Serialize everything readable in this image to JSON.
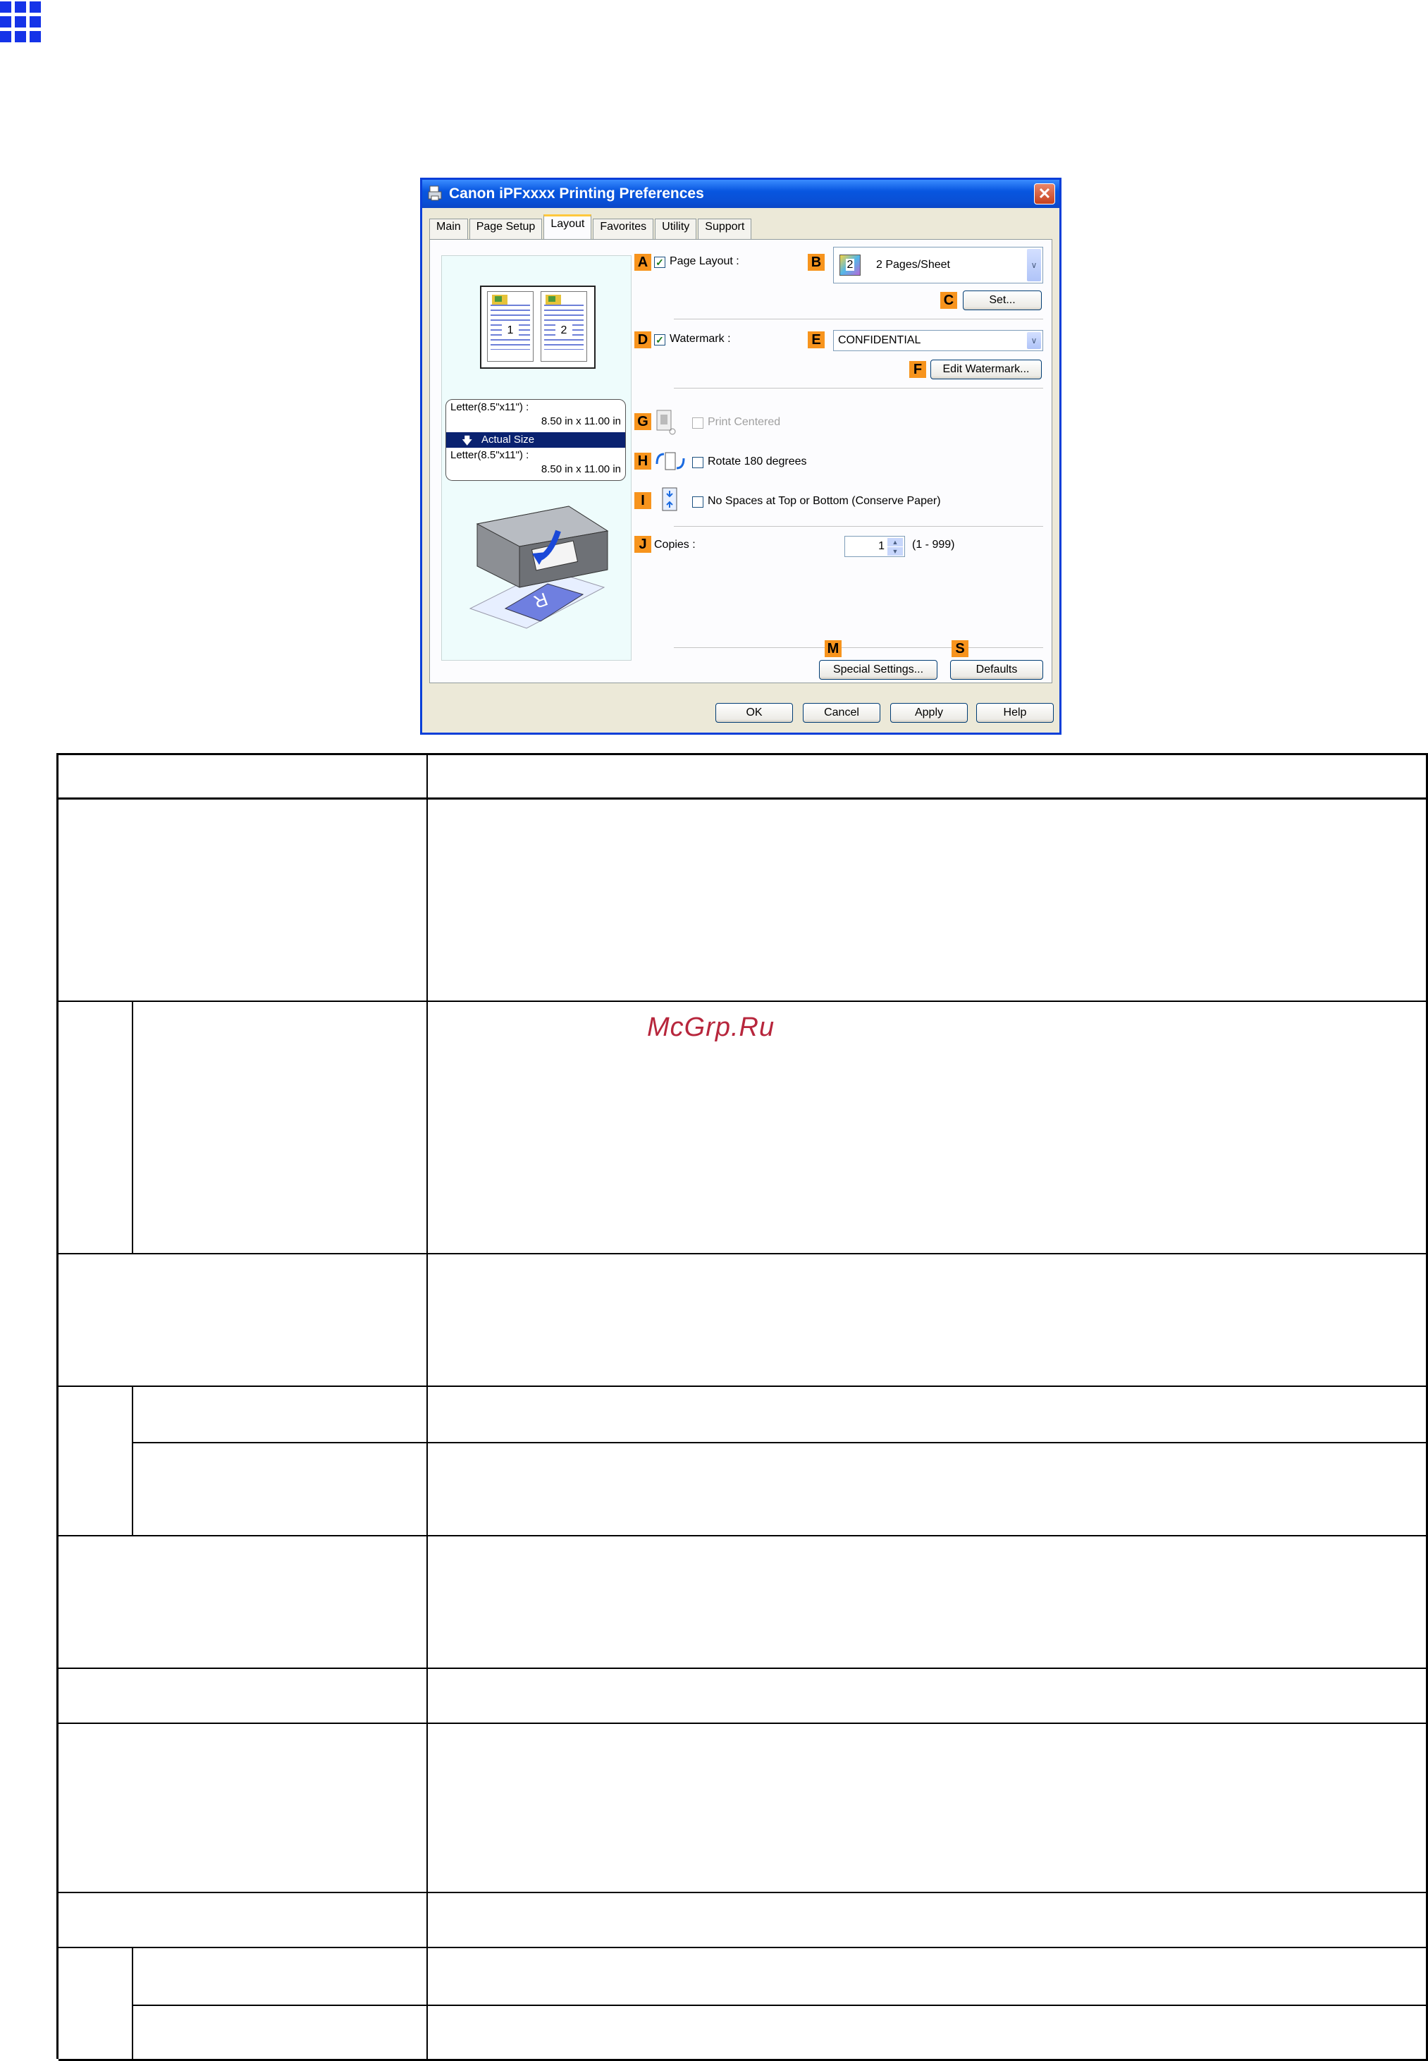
{
  "page": {
    "watermark_text": "McGrp.Ru"
  },
  "dialog": {
    "title": "Canon iPFxxxx Printing Preferences",
    "close_label": "✕",
    "tabs": [
      "Main",
      "Page Setup",
      "Layout",
      "Favorites",
      "Utility",
      "Support"
    ],
    "active_tab": "Layout",
    "preview": {
      "page_numbers": [
        "1",
        "2"
      ],
      "original_size": "Letter(8.5\"x11\") :",
      "original_dims": "8.50 in x 11.00 in",
      "scaling": "Actual Size",
      "output_size": "Letter(8.5\"x11\") :",
      "output_dims": "8.50 in x 11.00 in"
    },
    "markers": {
      "A": "A",
      "B": "B",
      "C": "C",
      "D": "D",
      "E": "E",
      "F": "F",
      "G": "G",
      "H": "H",
      "I": "I",
      "J": "J",
      "M": "M",
      "S": "S"
    },
    "page_layout": {
      "label": "Page Layout :",
      "checked": true,
      "value": "2 Pages/Sheet",
      "icon_digit": "2"
    },
    "set_button": "Set...",
    "watermark": {
      "label": "Watermark :",
      "checked": true,
      "value": "CONFIDENTIAL"
    },
    "edit_watermark_button": "Edit Watermark...",
    "print_centered": {
      "label": "Print Centered",
      "checked": false,
      "enabled": false
    },
    "rotate": {
      "label": "Rotate 180 degrees",
      "checked": false
    },
    "no_spaces": {
      "label": "No Spaces at Top or Bottom (Conserve Paper)",
      "checked": false
    },
    "copies": {
      "label": "Copies :",
      "value": "1",
      "range": "(1 - 999)"
    },
    "special_settings_button": "Special Settings...",
    "defaults_button": "Defaults",
    "footer_buttons": {
      "ok": "OK",
      "cancel": "Cancel",
      "apply": "Apply",
      "help": "Help"
    },
    "colors": {
      "marker": "#f7941d",
      "titlebar": "#0a4fd4"
    }
  }
}
